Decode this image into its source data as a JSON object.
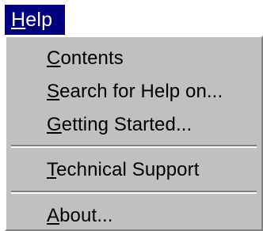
{
  "menu": {
    "title_mnemonic": "H",
    "title_rest": "elp"
  },
  "items": [
    {
      "mnemonic": "C",
      "rest": "ontents"
    },
    {
      "mnemonic": "S",
      "rest": "earch for Help on..."
    },
    {
      "mnemonic": "G",
      "rest": "etting Started..."
    },
    {
      "mnemonic": "T",
      "rest": "echnical Support"
    },
    {
      "mnemonic": "A",
      "rest": "bout..."
    }
  ],
  "colors": {
    "menu_highlight": "#000080",
    "menu_face": "#c0c0c0"
  }
}
